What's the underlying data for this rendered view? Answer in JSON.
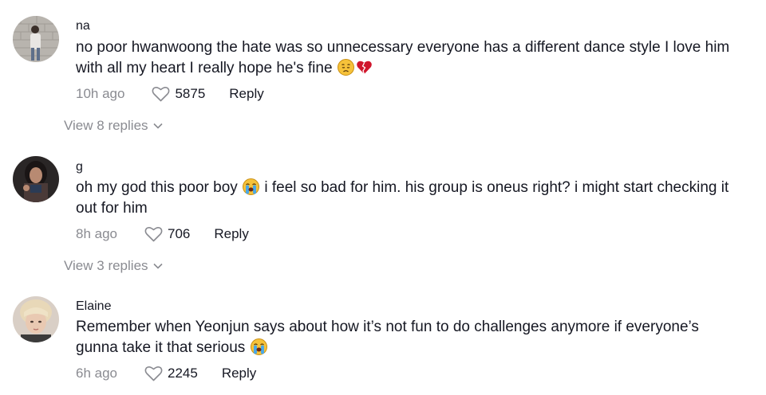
{
  "comments": [
    {
      "username": "na",
      "text": "no poor hwanwoong the hate was so unnecessary everyone has a different dance style I love him with all my heart I really hope he's fine",
      "emojis": [
        "disappointed-face-emoji",
        "broken-heart-emoji"
      ],
      "time": "10h ago",
      "likes": "5875",
      "reply_label": "Reply",
      "view_replies": "View 8 replies"
    },
    {
      "username": "g",
      "text_before": "oh my god this poor boy",
      "text_after": "i feel so bad for him. his group is oneus right? i might start checking it out for him",
      "emojis": [
        "loudly-crying-face-emoji"
      ],
      "time": "8h ago",
      "likes": "706",
      "reply_label": "Reply",
      "view_replies": "View 3 replies"
    },
    {
      "username": "Elaine",
      "text": "Remember when Yeonjun says about how it’s not fun to do challenges anymore if everyone’s gunna take it that serious",
      "emojis": [
        "loudly-crying-face-emoji"
      ],
      "time": "6h ago",
      "likes": "2245",
      "reply_label": "Reply"
    }
  ],
  "colors": {
    "text": "#161823",
    "muted": "#8a8b91",
    "background": "#ffffff"
  }
}
